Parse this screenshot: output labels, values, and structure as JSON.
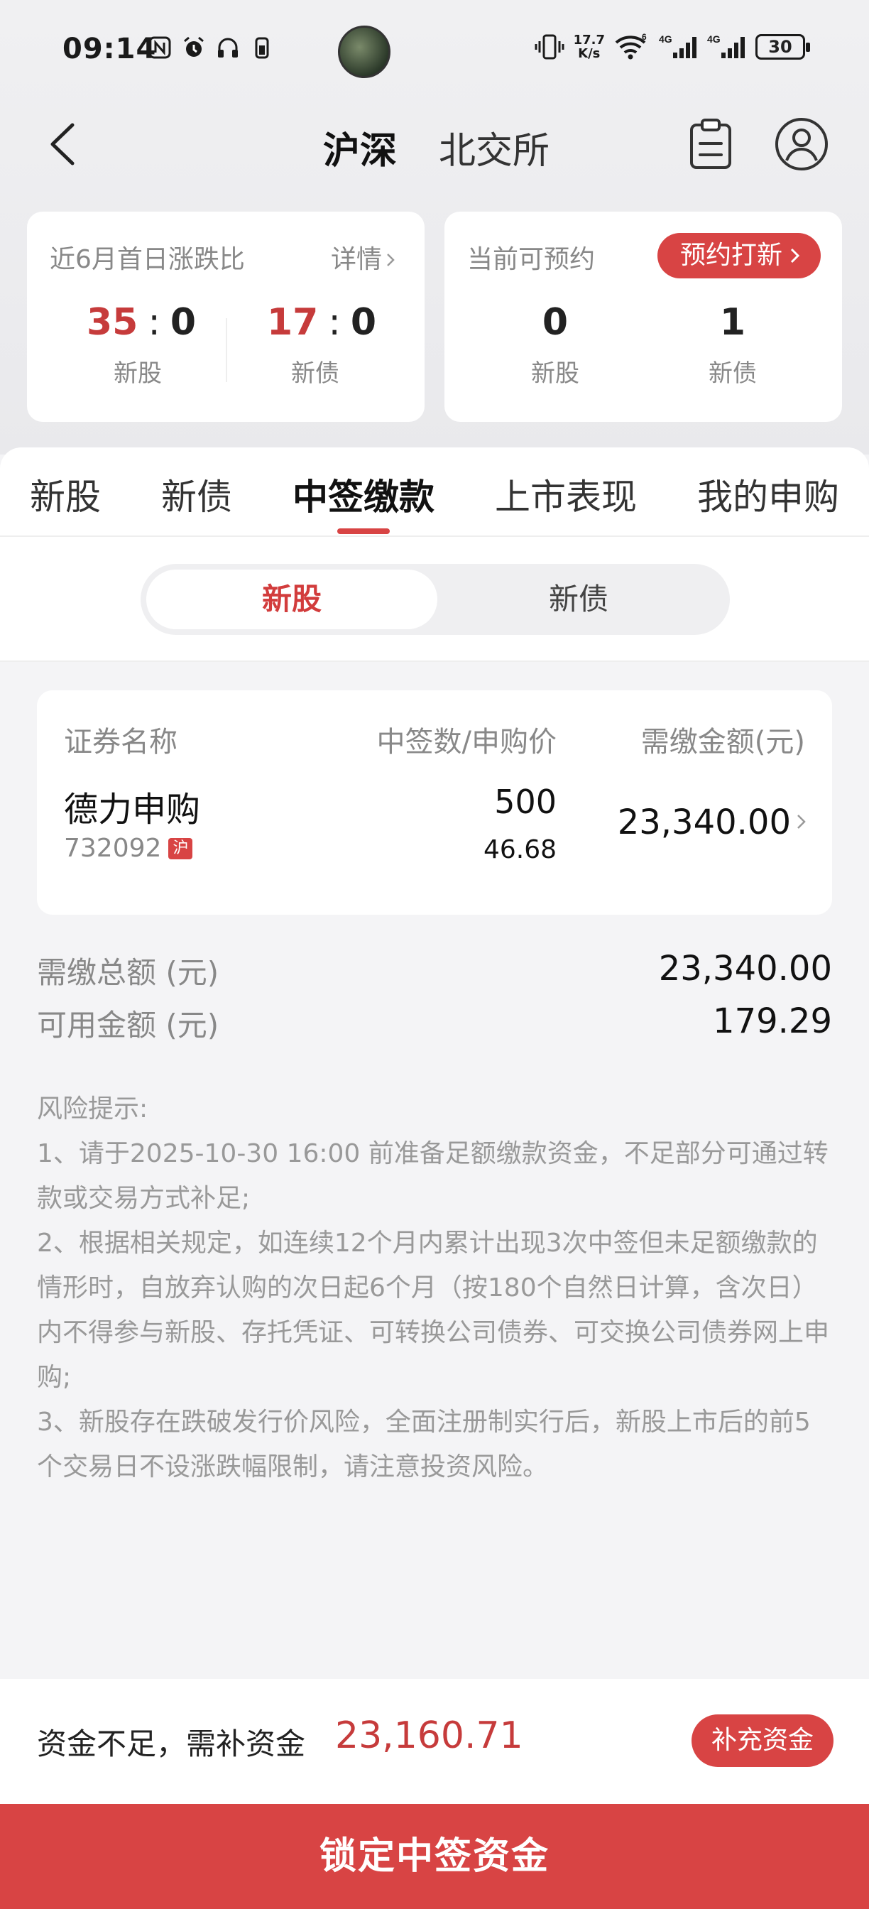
{
  "status_bar": {
    "time": "09:14",
    "net_speed_value": "17.7",
    "net_speed_unit": "K/s",
    "battery": "30"
  },
  "header": {
    "back_icon": "chevron-left-icon",
    "tab_active": "沪深",
    "tab_other": "北交所",
    "icons": [
      "clipboard-icon",
      "user-icon"
    ]
  },
  "summary_cards": {
    "first_day": {
      "title": "近6月首日涨跌比",
      "link": "详情",
      "stock_up": "35",
      "stock_down": "0",
      "stock_label": "新股",
      "bond_up": "17",
      "bond_down": "0",
      "bond_label": "新债",
      "separator": ":"
    },
    "bookable": {
      "title": "当前可预约",
      "button": "预约打新",
      "stock_count": "0",
      "stock_label": "新股",
      "bond_count": "1",
      "bond_label": "新债"
    }
  },
  "tabs": [
    "新股",
    "新债",
    "中签缴款",
    "上市表现",
    "我的申购"
  ],
  "active_tab": "中签缴款",
  "segment": {
    "active": "新股",
    "inactive": "新债"
  },
  "table": {
    "headers": [
      "证券名称",
      "中签数/申购价",
      "需缴金额(元)"
    ],
    "rows": [
      {
        "name": "德力申购",
        "code": "732092",
        "market": "沪",
        "qty": "500",
        "price": "46.68",
        "amount": "23,340.00"
      }
    ]
  },
  "summary": {
    "total_label": "需缴总额 (元)",
    "total_value": "23,340.00",
    "available_label": "可用金额 (元)",
    "available_value": "179.29"
  },
  "risk": {
    "title": "风险提示:",
    "items": [
      "1、请于2025-10-30 16:00 前准备足额缴款资金，不足部分可通过转款或交易方式补足;",
      "2、根据相关规定，如连续12个月内累计出现3次中签但未足额缴款的情形时，自放弃认购的次日起6个月（按180个自然日计算，含次日）内不得参与新股、存托凭证、可转换公司债券、可交换公司债券网上申购;",
      "3、新股存在跌破发行价风险，全面注册制实行后，新股上市后的前5个交易日不设涨跌幅限制，请注意投资风险。"
    ]
  },
  "bottom": {
    "shortfall_label": "资金不足，需补资金",
    "shortfall_amount": "23,160.71",
    "topup_button": "补充资金",
    "lock_button": "锁定中签资金"
  },
  "colors": {
    "accent": "#d84444",
    "up_red": "#c63b3b"
  }
}
